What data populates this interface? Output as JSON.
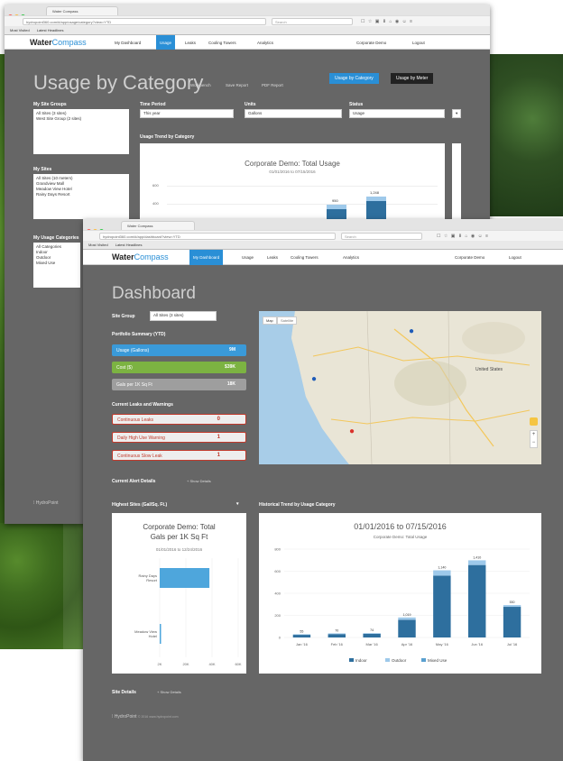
{
  "back_window": {
    "tab_title": "Water Compass",
    "url": "hydropoint360.com/#/app/usage/category?view=YTD",
    "search_placeholder": "Search",
    "bookmarks": [
      "Most Visited",
      "Latest Headlines"
    ],
    "nav": {
      "logo_bold": "Water",
      "logo_light": "Compass",
      "items": [
        "My Dashboard",
        "Usage",
        "Leaks",
        "Cooling Towers",
        "Analytics"
      ],
      "active": "Usage",
      "right": [
        "Corporate Demo",
        "Logout"
      ]
    },
    "title": "Usage by Category",
    "title_links": [
      "Workbench",
      "Save Report",
      "PDF Report"
    ],
    "view_buttons": [
      "Usage by Category",
      "Usage by Meter"
    ],
    "my_site_groups_label": "My Site Groups",
    "site_groups": [
      "All Sites (3 sites)",
      "West Site Group (2 sites)"
    ],
    "my_sites_label": "My Sites",
    "sites": [
      "All Sites (10 meters)",
      "Grandview Mall",
      "Meadow View Hotel",
      "Rainy Days Resort"
    ],
    "usage_categories_label": "My Usage Categories",
    "usage_categories": [
      "All Categories",
      "Indoor",
      "Outdoor",
      "Mixed Use"
    ],
    "time_period_label": "Time Period",
    "time_period_value": "This year",
    "units_label": "Units",
    "units_value": "Gallons",
    "status_label": "Status",
    "status_value": "Usage",
    "trend_label": "Usage Trend by Category",
    "chart_title": "Corporate Demo: Total Usage",
    "chart_subtitle": "01/01/2016 to 07/15/2016",
    "chart_yticks": [
      "600",
      "400"
    ],
    "bar_labels": [
      "950",
      "1,248"
    ],
    "footer_brand": "HydroPoint"
  },
  "front_window": {
    "tab_title": "Water Compass",
    "url": "hydropoint360.com/#/app/dashboard?view=YTD",
    "search_placeholder": "Search",
    "bookmarks": [
      "Most Visited",
      "Latest Headlines"
    ],
    "nav": {
      "logo_bold": "Water",
      "logo_light": "Compass",
      "items": [
        "My Dashboard",
        "Usage",
        "Leaks",
        "Cooling Towers",
        "Analytics"
      ],
      "active": "My Dashboard",
      "right": [
        "Corporate Demo",
        "Logout"
      ]
    },
    "title": "Dashboard",
    "site_group_label": "Site Group",
    "site_group_value": "All Sites (3 sites)",
    "portfolio_label": "Portfolio Summary (YTD)",
    "portfolio": [
      {
        "label": "Usage (Gallons)",
        "value": "9M",
        "color": "#3a9ad9"
      },
      {
        "label": "Cost ($)",
        "value": "$39K",
        "color": "#7cb342"
      },
      {
        "label": "Gals per 1K Sq Ft",
        "value": "18K",
        "color": "#9e9e9e"
      }
    ],
    "leaks_label": "Current Leaks and Warnings",
    "leaks": [
      {
        "label": "Continuous Leaks",
        "value": "0"
      },
      {
        "label": "Daily High Use Warning",
        "value": "1"
      },
      {
        "label": "Continuous Slow Leak",
        "value": "1"
      }
    ],
    "map": {
      "tabs": [
        "Map",
        "Satellite"
      ],
      "country_label": "United States"
    },
    "alert_details_label": "Current Alert Details",
    "alert_details_link": "Show Details",
    "highest_sites_label": "Highest Sites (Gal/Sq. Ft.)",
    "historical_label": "Historical Trend by Usage Category",
    "site_details_label": "Site Details",
    "site_details_link": "Show Details",
    "footer_brand": "HydroPoint",
    "footer_text": "© 2016  www.hydropoint.com"
  },
  "chart_data": [
    {
      "type": "bar",
      "title": "Corporate Demo: Total Gals per 1K Sq Ft",
      "subtitle": "01/01/2016 to 12/24/2016",
      "orientation": "horizontal",
      "categories": [
        "Rainy Days Resort",
        "Meadow View Hotel"
      ],
      "values": [
        38,
        1
      ],
      "xticks": [
        "2K",
        "20K",
        "40K",
        "60K"
      ],
      "colors": [
        "#4ea6dc"
      ]
    },
    {
      "type": "bar",
      "title": "01/01/2016 to 07/15/2016",
      "subtitle": "Corporate Demo: Total Usage",
      "stacked": true,
      "categories": [
        "Jan '16",
        "Feb '16",
        "Mar '16",
        "Apr '16",
        "May '16",
        "Jun '16",
        "Jul '16"
      ],
      "series": [
        {
          "name": "Indoor",
          "values": [
            45,
            58,
            62,
            300,
            1050,
            1230,
            520
          ],
          "color": "#2e6f9e"
        },
        {
          "name": "Outdoor",
          "values": [
            10,
            12,
            12,
            40,
            90,
            80,
            30
          ],
          "color": "#9ec9ea"
        },
        {
          "name": "Mixed Use",
          "values": [
            0,
            0,
            0,
            0,
            0,
            0,
            0
          ],
          "color": "#5aa0d0"
        }
      ],
      "bar_labels": [
        "55",
        "70",
        "74",
        "1,019",
        "1,140",
        "1,410",
        "530"
      ],
      "yticks": [
        "800",
        "600",
        "400",
        "200",
        "0"
      ],
      "ylim": [
        0,
        1500
      ]
    }
  ]
}
